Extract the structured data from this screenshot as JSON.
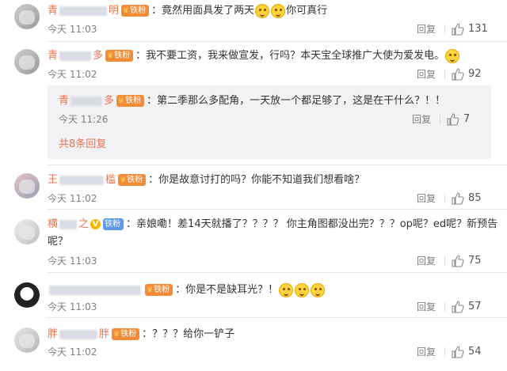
{
  "ui": {
    "reply_label": "回复",
    "more_replies": "共8条回复"
  },
  "comments": [
    {
      "name_prefix": "青",
      "name_suffix": "明",
      "badge": "铁粉",
      "text_a": "竟然用面具发了两天",
      "emojis": [
        "smiley-emoji",
        "smiley-emoji"
      ],
      "text_b": "你可真行",
      "time": "今天 11:03",
      "likes": "131"
    },
    {
      "name_prefix": "青",
      "name_suffix": "多",
      "badge": "铁粉",
      "text": "我不要工资，我来做宣发，行吗？本天宝全球推广大使为爱发电。",
      "time": "今天 11:02",
      "likes": "92"
    },
    {
      "name_prefix": "青",
      "name_suffix": "多",
      "badge": "铁粉",
      "text": "第二季那么多配角，一天放一个都足够了，这是在干什么？！！",
      "time": "今天 11:26",
      "likes": "7"
    },
    {
      "name_prefix": "王",
      "name_suffix": "槛",
      "badge": "铁粉",
      "text": "你是故意讨打的吗？你能不知道我们想看啥？",
      "time": "今天 11:02",
      "likes": "85"
    },
    {
      "name_prefix": "横",
      "name_suffix": "之",
      "badge": "铁粉",
      "text_line1": "亲娘嘞！差14天就播了？？？？ 你主角图都没出完？？？op呢？ed呢？新预告",
      "text_line2": "呢？",
      "time": "今天 11:03",
      "likes": "75"
    },
    {
      "name_prefix": "",
      "name_suffix": "",
      "badge": "铁粉",
      "text": "你是不是缺耳光？！",
      "time": "今天 11:03",
      "likes": "57"
    },
    {
      "name_prefix": "胖",
      "name_suffix": "胖",
      "badge": "铁粉",
      "text": "？？？给你一铲子",
      "time": "今天 11:02",
      "likes": "54"
    }
  ]
}
